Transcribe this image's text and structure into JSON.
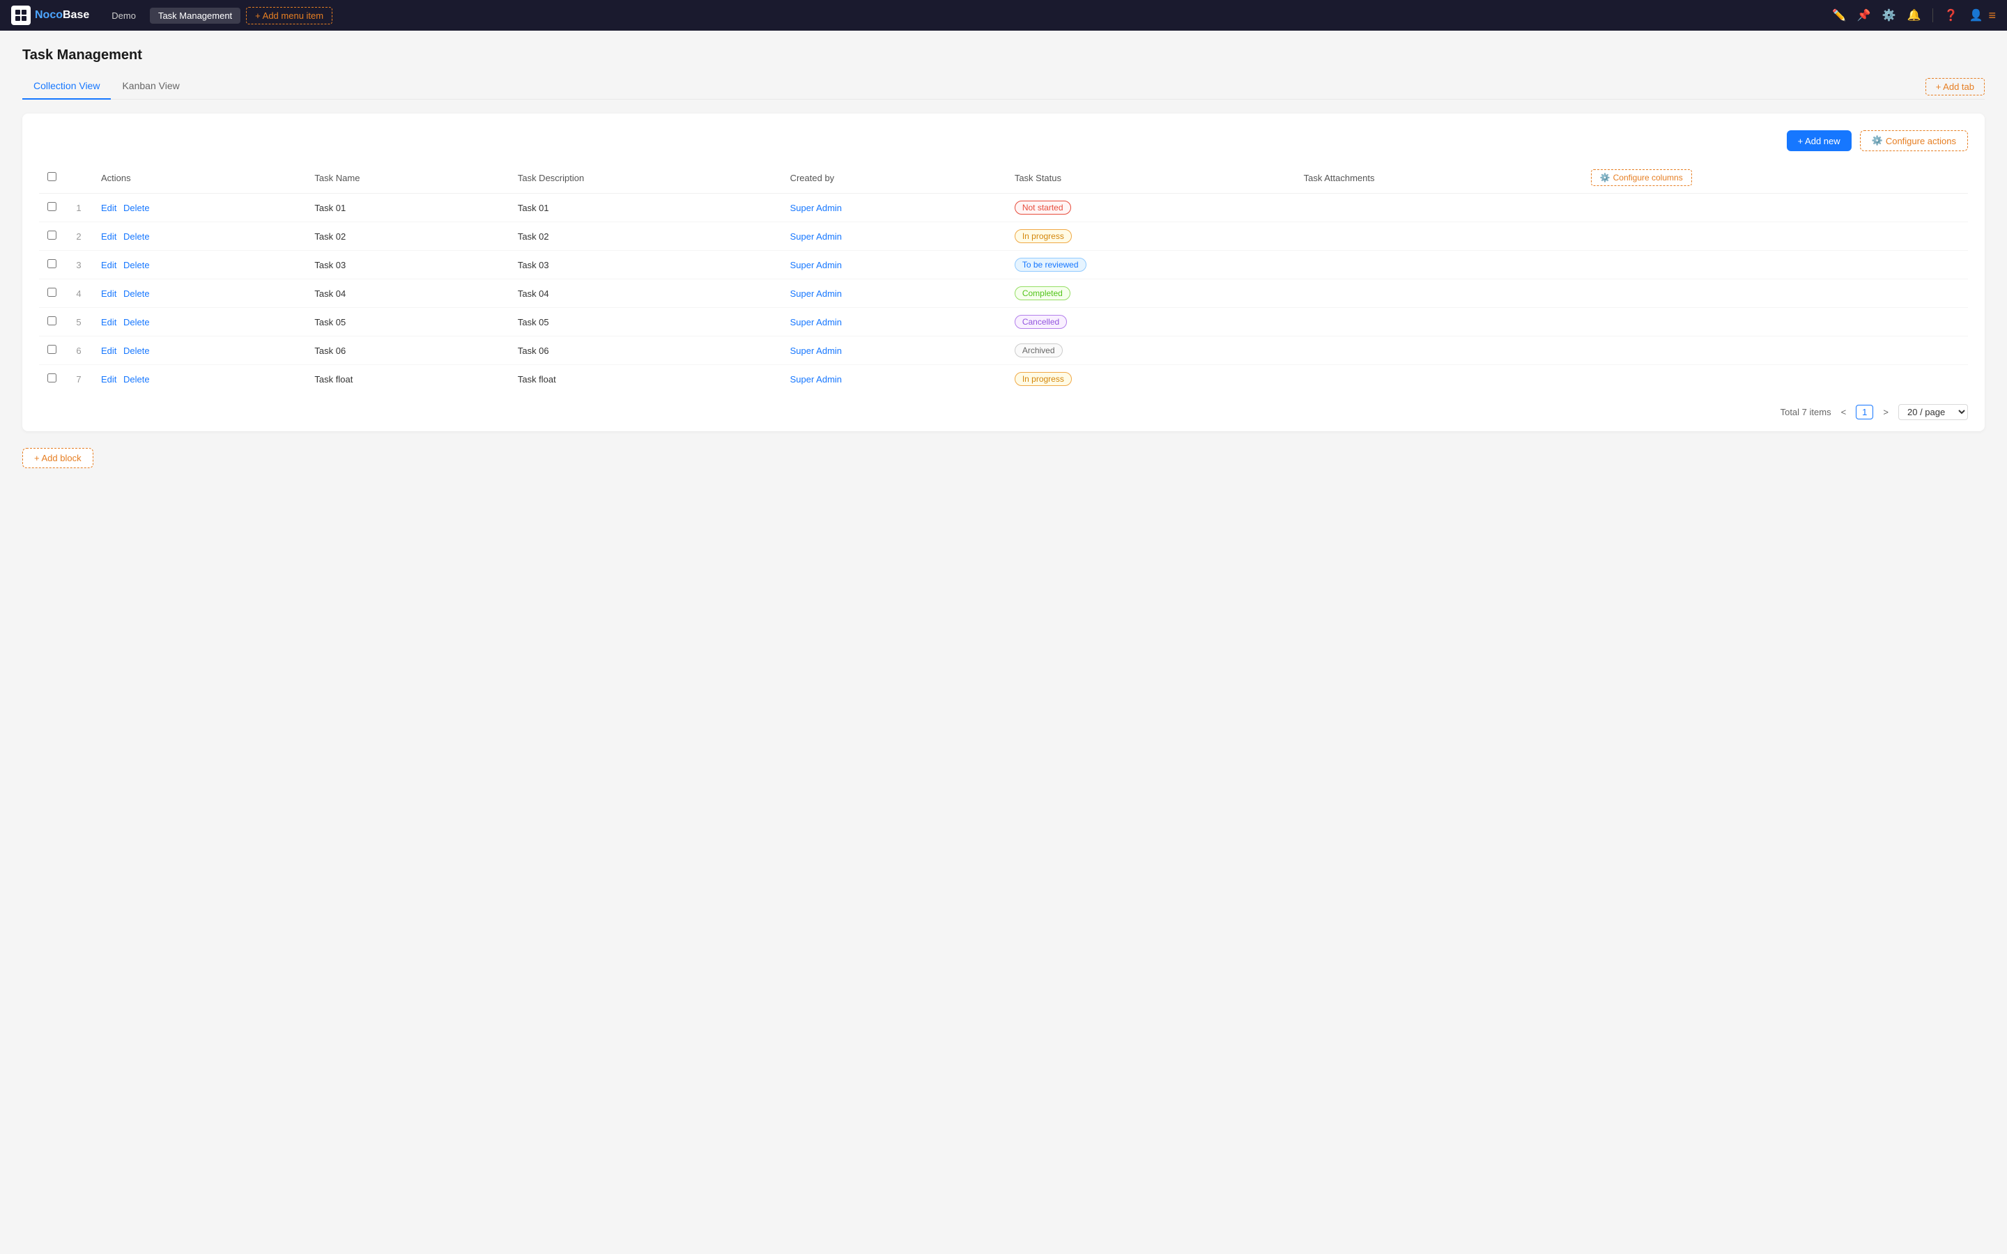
{
  "app": {
    "logo_text": "Noco",
    "logo_accent": "Base",
    "nav_items": [
      {
        "label": "Demo",
        "active": false
      },
      {
        "label": "Task Management",
        "active": true
      }
    ],
    "add_menu_item_label": "+ Add menu item",
    "topnav_icons": [
      "pencil",
      "pin",
      "gear",
      "bell",
      "question",
      "user"
    ],
    "menu_icon": "≡"
  },
  "page": {
    "title": "Task Management",
    "tabs": [
      {
        "label": "Collection View",
        "active": true
      },
      {
        "label": "Kanban View",
        "active": false
      }
    ],
    "add_tab_label": "+ Add tab"
  },
  "toolbar": {
    "add_new_label": "+ Add new",
    "configure_actions_label": "Configure actions"
  },
  "table": {
    "columns": [
      {
        "key": "actions",
        "label": "Actions"
      },
      {
        "key": "task_name",
        "label": "Task Name"
      },
      {
        "key": "task_description",
        "label": "Task Description"
      },
      {
        "key": "created_by",
        "label": "Created by"
      },
      {
        "key": "task_status",
        "label": "Task Status"
      },
      {
        "key": "task_attachments",
        "label": "Task Attachments"
      }
    ],
    "configure_columns_label": "Configure columns",
    "rows": [
      {
        "num": 1,
        "task_name": "Task 01",
        "task_description": "Task 01",
        "created_by": "Super Admin",
        "task_status": "Not started",
        "status_class": "badge-not-started"
      },
      {
        "num": 2,
        "task_name": "Task 02",
        "task_description": "Task 02",
        "created_by": "Super Admin",
        "task_status": "In progress",
        "status_class": "badge-in-progress"
      },
      {
        "num": 3,
        "task_name": "Task 03",
        "task_description": "Task 03",
        "created_by": "Super Admin",
        "task_status": "To be reviewed",
        "status_class": "badge-to-be-reviewed"
      },
      {
        "num": 4,
        "task_name": "Task 04",
        "task_description": "Task 04",
        "created_by": "Super Admin",
        "task_status": "Completed",
        "status_class": "badge-completed"
      },
      {
        "num": 5,
        "task_name": "Task 05",
        "task_description": "Task 05",
        "created_by": "Super Admin",
        "task_status": "Cancelled",
        "status_class": "badge-cancelled"
      },
      {
        "num": 6,
        "task_name": "Task 06",
        "task_description": "Task 06",
        "created_by": "Super Admin",
        "task_status": "Archived",
        "status_class": "badge-archived"
      },
      {
        "num": 7,
        "task_name": "Task float",
        "task_description": "Task float",
        "created_by": "Super Admin",
        "task_status": "In progress",
        "status_class": "badge-in-progress"
      }
    ],
    "edit_label": "Edit",
    "delete_label": "Delete",
    "pagination": {
      "total_label": "Total 7 items",
      "current_page": 1,
      "page_size_label": "20 / page"
    }
  },
  "add_block_label": "+ Add block"
}
